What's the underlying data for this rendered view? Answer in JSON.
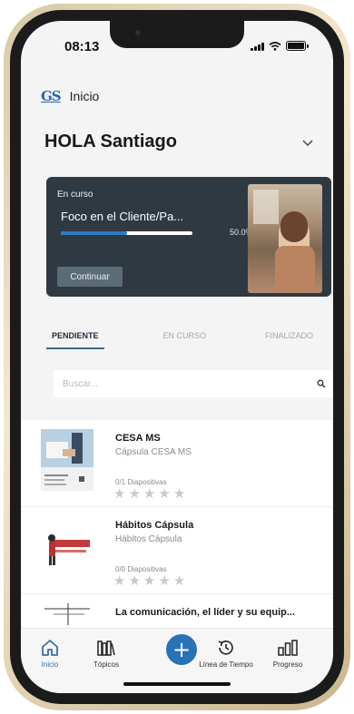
{
  "status_bar": {
    "time": "08:13"
  },
  "header": {
    "title": "Inicio",
    "logo_text": "GS"
  },
  "greeting": "HOLA Santiago",
  "current_course": {
    "status": "En curso",
    "title": "Foco en el Cliente/Pa...",
    "progress": 0.5,
    "progress_label": "50.0%",
    "continue_label": "Continuar"
  },
  "tabs": [
    {
      "label": "PENDIENTE",
      "active": true
    },
    {
      "label": "EN CURSO",
      "active": false
    },
    {
      "label": "FINALIZADO",
      "active": false
    }
  ],
  "search": {
    "placeholder": "Buscar..."
  },
  "items": [
    {
      "title": "CESA MS",
      "subtitle": "Cápsula CESA MS",
      "count": "0/1",
      "count_label": "Diapositivas",
      "stars": 0
    },
    {
      "title": "Hábitos Cápsula",
      "subtitle": "Hábitos Cápsula",
      "count": "0/0",
      "count_label": "Diapositivas",
      "stars": 0
    },
    {
      "title": "La comunicación, el líder y su equip...",
      "subtitle": "",
      "count": "",
      "count_label": "",
      "stars": 0
    }
  ],
  "tab_bar": {
    "items": [
      {
        "label": "Inicio",
        "icon": "home-icon",
        "active": true
      },
      {
        "label": "Tópicos",
        "icon": "books-icon",
        "active": false
      },
      {
        "label": "Línea de Tiempo",
        "icon": "history-icon",
        "active": false
      },
      {
        "label": "Progreso",
        "icon": "bar-chart-icon",
        "active": false
      }
    ],
    "add_label": "+"
  },
  "colors": {
    "accent": "#2a72b6",
    "card_bg": "#2f3942",
    "progress": "#2b7bc9"
  }
}
